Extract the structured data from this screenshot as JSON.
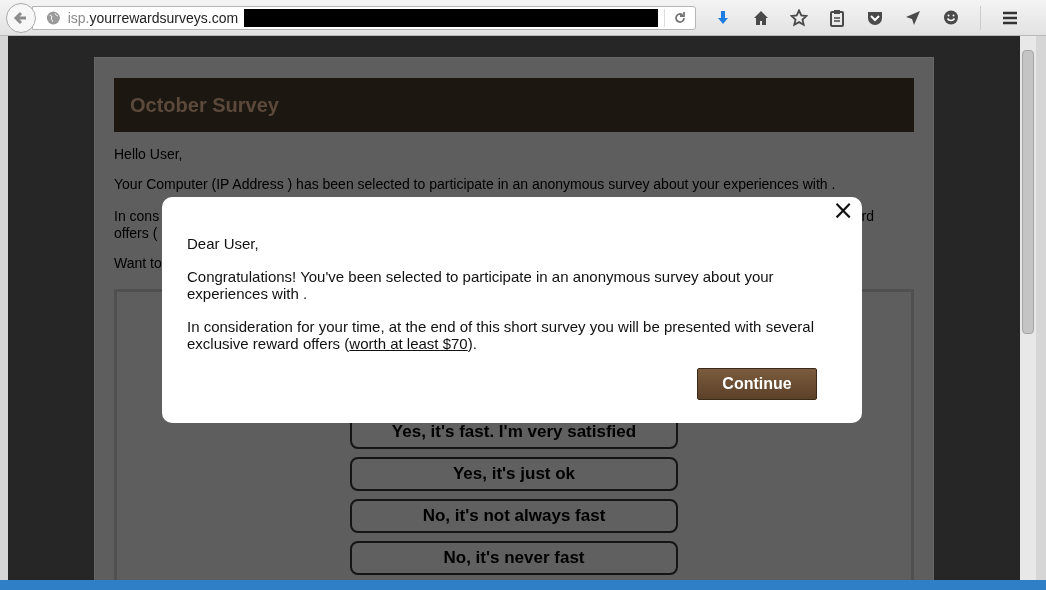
{
  "browser": {
    "url_subdomain": "isp.",
    "url_domain": "yourrewardsurveys.com"
  },
  "page": {
    "title": "October Survey",
    "greeting": "Hello User,",
    "intro": "Your Computer (IP Address ) has been selected to participate in an anonymous survey about your experiences with .",
    "covered_line_start": "In cons",
    "covered_line_end": "rd",
    "covered_line2_start": "offers (",
    "covered_line3_start": "Want to",
    "answers": [
      "Yes, it's fast. I'm very satisfied",
      "Yes, it's just ok",
      "No, it's not always fast",
      "No, it's never fast"
    ]
  },
  "modal": {
    "close": "×",
    "greeting": "Dear User,",
    "paragraph_1": "Congratulations! You've been selected to participate in an anonymous survey about your experiences with .",
    "paragraph_2_text": "In consideration for your time, at the end of this short survey you will be presented with several exclusive reward offers (",
    "paragraph_2_link": "worth at least $70",
    "paragraph_2_end": ").",
    "button": "Continue"
  }
}
